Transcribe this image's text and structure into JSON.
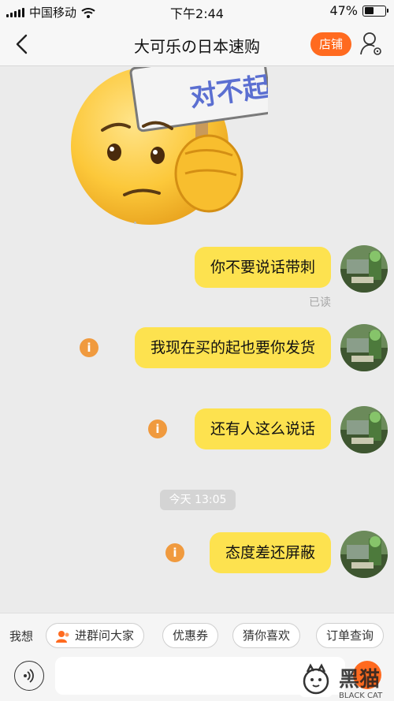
{
  "status_bar": {
    "carrier": "中国移动",
    "time": "下午2:44",
    "battery": "47%",
    "battery_level": 0.47
  },
  "nav": {
    "title": "大可乐の日本速购",
    "shop_button": "店铺",
    "back_icon": "chevron-left-icon",
    "profile_icon": "user-settings-icon"
  },
  "messages": [
    {
      "text": "你不要说话带刺",
      "status": "已读"
    },
    {
      "text": "我现在买的起也要你发货"
    },
    {
      "text": "还有人这么说话"
    },
    {
      "timestamp": "今天 13:05"
    },
    {
      "text": "态度差还屏蔽"
    }
  ],
  "quick_bar": {
    "label": "我想",
    "chips": [
      "进群问大家",
      "优惠券",
      "猜你喜欢",
      "订单查询"
    ]
  },
  "input": {
    "placeholder": ""
  },
  "watermark": {
    "text": "黑猫",
    "subtext": "BLACK CAT"
  },
  "colors": {
    "bubble": "#fde24f",
    "accent": "#ff6a1f",
    "info": "#f09a3e",
    "chat_bg": "#ebebeb"
  }
}
